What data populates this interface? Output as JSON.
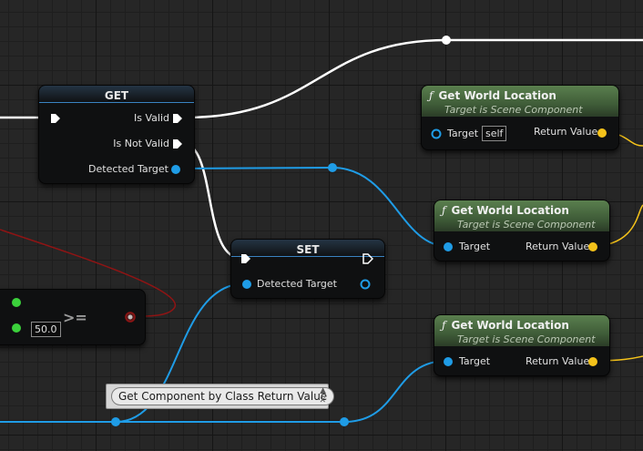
{
  "colors": {
    "canvas_bg": "#262626",
    "exec_wire": "#ffffff",
    "object_pin": "#1f9ce6",
    "vector_pin": "#f4c21a",
    "bool_wire": "#8f1414",
    "float_pin": "#3bd13b",
    "function_header": "#4f7146",
    "variable_header": "#3a83c2"
  },
  "get_node": {
    "title": "GET",
    "pins": {
      "is_valid": "Is Valid",
      "is_not_valid": "Is Not Valid",
      "detected_target": "Detected Target"
    }
  },
  "set_node": {
    "title": "SET",
    "pins": {
      "detected_target": "Detected Target"
    }
  },
  "compare_node": {
    "operator": ">=",
    "default_value": "50.0"
  },
  "world_location_nodes": [
    {
      "title": "Get World Location",
      "subtitle": "Target is Scene Component",
      "target_label": "Target",
      "target_default": "self",
      "return_label": "Return Value"
    },
    {
      "title": "Get World Location",
      "subtitle": "Target is Scene Component",
      "target_label": "Target",
      "return_label": "Return Value"
    },
    {
      "title": "Get World Location",
      "subtitle": "Target is Scene Component",
      "target_label": "Target",
      "return_label": "Return Value"
    }
  ],
  "function_glyph": "ƒ",
  "tooltip": {
    "text": "Get Component by Class Return Value",
    "pin_icon": "pin-icon",
    "close_icon": "close-icon"
  }
}
